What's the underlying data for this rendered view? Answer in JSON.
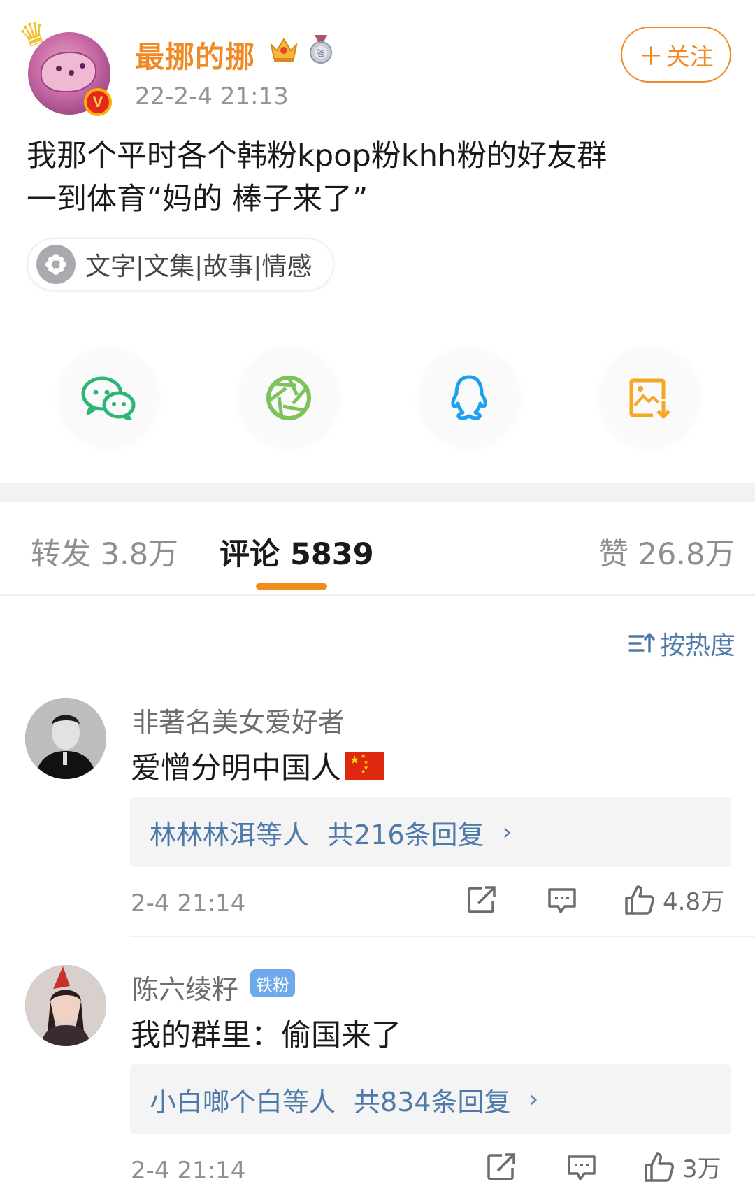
{
  "post": {
    "username": "最挪的挪",
    "timestamp": "22-2-4 21:13",
    "follow_label": "关注",
    "text_line1": "我那个平时各个韩粉kpop粉khh粉的好友群",
    "text_line2": "一到体育“妈的 棒子来了”",
    "topic": "文字|文集|故事|情感",
    "avatar_badge": "V"
  },
  "share": {
    "icons": [
      "wechat-icon",
      "moments-icon",
      "qq-icon",
      "save-image-icon"
    ]
  },
  "tabs": {
    "repost": "转发 3.8万",
    "comments": "评论 5839",
    "likes": "赞 26.8万"
  },
  "sort": {
    "label": "按热度"
  },
  "comments": [
    {
      "name": "非著名美女爱好者",
      "text": "爱憎分明中国人",
      "reply_users": "林林林洱等人",
      "reply_count": "共216条回复",
      "time": "2-4 21:14",
      "likes": "4.8万"
    },
    {
      "name": "陈六绫籽",
      "badge": "铁粉",
      "text": "我的群里：偷国来了",
      "reply_users": "小白啷个白等人",
      "reply_count": "共834条回复",
      "time": "2-4 21:14",
      "likes": "3万"
    }
  ],
  "colors": {
    "accent_orange": "#f08a26",
    "link_blue": "#4d7aa9",
    "wechat_green": "#07c160",
    "moments_green": "#7bc35a",
    "qq_blue": "#1ea0f0",
    "save_yellow": "#f5a623"
  }
}
